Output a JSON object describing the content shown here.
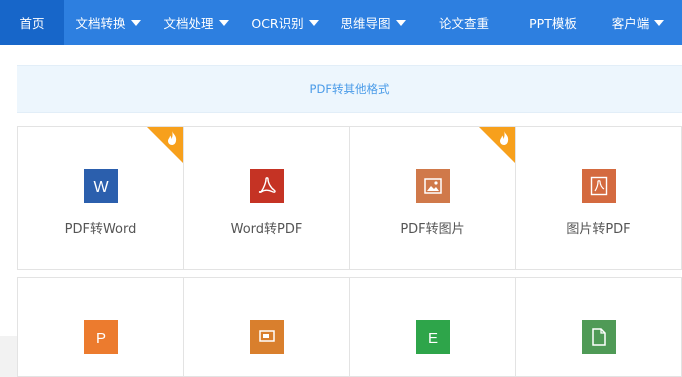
{
  "nav": {
    "items": [
      {
        "label": "首页",
        "active": true,
        "dropdown": false
      },
      {
        "label": "文档转换",
        "active": false,
        "dropdown": true
      },
      {
        "label": "文档处理",
        "active": false,
        "dropdown": true
      },
      {
        "label": "OCR识别",
        "active": false,
        "dropdown": true
      },
      {
        "label": "思维导图",
        "active": false,
        "dropdown": true
      },
      {
        "label": "论文查重",
        "active": false,
        "dropdown": false
      },
      {
        "label": "PPT模板",
        "active": false,
        "dropdown": false
      },
      {
        "label": "客户端",
        "active": false,
        "dropdown": true
      }
    ]
  },
  "banner": {
    "title": "PDF转其他格式"
  },
  "tools": [
    {
      "label": "PDF转Word",
      "icon": "word-icon",
      "color": "#2b5fad",
      "hot": true
    },
    {
      "label": "Word转PDF",
      "icon": "pdf-icon",
      "color": "#c53324",
      "hot": false
    },
    {
      "label": "PDF转图片",
      "icon": "image-icon",
      "color": "#d0794a",
      "hot": true
    },
    {
      "label": "图片转PDF",
      "icon": "pdf-icon",
      "color": "#d46a3f",
      "hot": false
    },
    {
      "label": "",
      "icon": "ppt-icon",
      "color": "#ec7b2e",
      "hot": false
    },
    {
      "label": "",
      "icon": "presentation-icon",
      "color": "#d97f2d",
      "hot": false
    },
    {
      "label": "",
      "icon": "excel-icon",
      "color": "#2ea54a",
      "hot": false
    },
    {
      "label": "",
      "icon": "file-icon",
      "color": "#4f9a56",
      "hot": false
    }
  ],
  "colors": {
    "nav": "#2d7fe0",
    "nav_active": "#1766c9",
    "hot": "#f7a01c"
  }
}
